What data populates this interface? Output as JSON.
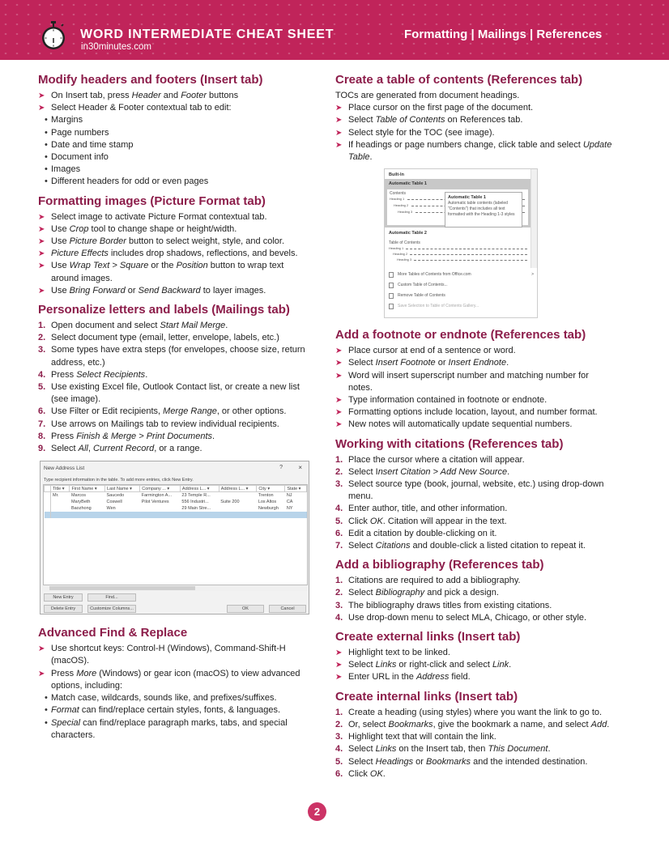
{
  "header": {
    "title": "WORD INTERMEDIATE CHEAT SHEET",
    "site": "in30minutes.com",
    "subtitle": "Formatting | Mailings | References",
    "logo_icon": "stopwatch-icon",
    "brand_color": "#c0245a",
    "heading_color": "#8c1d4a"
  },
  "left": {
    "headers_footers": {
      "heading": "Modify headers and footers (Insert tab)",
      "items": [
        [
          "On Insert tab, press ",
          {
            "i": "Header"
          },
          " and ",
          {
            "i": "Footer"
          },
          " buttons"
        ],
        [
          "Select Header & Footer contextual tab to edit:"
        ]
      ],
      "sub_items": [
        "Margins",
        "Page numbers",
        "Date and time stamp",
        "Document info",
        "Images",
        "Different headers for odd or even pages"
      ]
    },
    "images": {
      "heading": "Formatting images (Picture Format tab)",
      "items": [
        [
          "Select image to activate Picture Format contextual tab."
        ],
        [
          "Use ",
          {
            "i": "Crop"
          },
          " tool to change shape or height/width."
        ],
        [
          "Use ",
          {
            "i": "Picture Border"
          },
          " button to select weight, style, and color."
        ],
        [
          {
            "i": "Picture Effects"
          },
          " includes drop shadows, reflections, and bevels."
        ],
        [
          "Use ",
          {
            "i": "Wrap Text > Square"
          },
          " or the ",
          {
            "i": "Position"
          },
          " button to wrap text around images."
        ],
        [
          "Use ",
          {
            "i": "Bring Forward"
          },
          " or ",
          {
            "i": "Send Backward"
          },
          " to layer images."
        ]
      ]
    },
    "mailings": {
      "heading": "Personalize letters and labels (Mailings tab)",
      "items": [
        [
          "Open document and select ",
          {
            "i": "Start Mail Merge"
          },
          "."
        ],
        [
          "Select document type (email, letter, envelope, labels, etc.)"
        ],
        [
          "Some types have extra steps (for envelopes, choose size, return address, etc.)"
        ],
        [
          "Press ",
          {
            "i": "Select Recipients"
          },
          "."
        ],
        [
          "Use existing Excel file, Outlook Contact list, or create a new list (see image)."
        ],
        [
          "Use Filter or Edit recipients, ",
          {
            "i": "Merge Range"
          },
          ", or other options."
        ],
        [
          "Use arrows on Mailings tab to review individual recipients."
        ],
        [
          "Press ",
          {
            "i": "Finish & Merge > Print Documents"
          },
          "."
        ],
        [
          "Select ",
          {
            "i": "All"
          },
          ", ",
          {
            "i": "Current Record"
          },
          ", or a range."
        ]
      ]
    },
    "address_dialog": {
      "title": "New Address List",
      "help": "?",
      "close": "×",
      "hint": "Type recipient information in the table. To add more entries, click New Entry.",
      "columns": [
        "Title",
        "First Name",
        "Last Name",
        "Company ...",
        "Address L...",
        "Address L...",
        "City",
        "State"
      ],
      "rows": [
        [
          "Mr.",
          "Marcos",
          "Saucedo",
          "Farmington A...",
          "23 Temple R...",
          "",
          "Trenton",
          "NJ"
        ],
        [
          "",
          "MaryBeth",
          "Coswell",
          "Pilot Ventures",
          "556 Industri...",
          "Suite 200",
          "Los Altos",
          "CA"
        ],
        [
          "",
          "Baozhong",
          "Wen",
          "",
          "29 Main Stre...",
          "",
          "Newburgh",
          "NY"
        ],
        [
          "",
          "",
          "",
          "",
          "",
          "",
          "",
          ""
        ]
      ],
      "buttons": {
        "new_entry": "New Entry",
        "find": "Find...",
        "delete_entry": "Delete Entry",
        "customize": "Customize Columns...",
        "ok": "OK",
        "cancel": "Cancel"
      }
    },
    "find_replace": {
      "heading": "Advanced Find & Replace",
      "items": [
        [
          "Use shortcut keys: Control-H (Windows), Command-Shift-H (macOS)."
        ],
        [
          "Press ",
          {
            "i": "More"
          },
          " (Windows) or gear icon (macOS) to view advanced options, including:"
        ]
      ],
      "sub_items": [
        [
          "Match case, wildcards, sounds like, and prefixes/suffixes."
        ],
        [
          {
            "i": "Format"
          },
          " can find/replace certain styles, fonts, & languages."
        ],
        [
          {
            "i": "Special"
          },
          " can find/replace paragraph marks, tabs, and special characters."
        ]
      ]
    }
  },
  "right": {
    "toc": {
      "heading": "Create a table of contents (References tab)",
      "intro": "TOCs are generated from document headings.",
      "items": [
        [
          "Place cursor on the first page of the document."
        ],
        [
          "Select ",
          {
            "i": "Table of Contents"
          },
          " on References tab."
        ],
        [
          "Select style for the TOC (see image)."
        ],
        [
          "If headings or page numbers change, click table and select ",
          {
            "i": "Update Table"
          },
          "."
        ]
      ],
      "image": {
        "builtin": "Built-In",
        "auto1": "Automatic Table 1",
        "contents": "Contents",
        "h1": "Heading 1",
        "h2": "Heading 2",
        "h3": "Heading 3",
        "tip_title": "Automatic Table 1",
        "tip_text": "Automatic table contents (labeled \"Contents\") that includes all text formatted with the Heading 1-3 styles",
        "auto2": "Automatic Table 2",
        "toc_label": "Table of Contents",
        "menu": [
          {
            "label": "More Tables of Contents from Office.com",
            "disabled": false
          },
          {
            "label": "Custom Table of Contents...",
            "disabled": false
          },
          {
            "label": "Remove Table of Contents",
            "disabled": false
          },
          {
            "label": "Save Selection to Table of Contents Gallery...",
            "disabled": true
          }
        ],
        "submenu_arrow": ">"
      }
    },
    "footnote": {
      "heading": "Add a footnote or endnote (References tab)",
      "items": [
        [
          "Place cursor at end of a sentence or word."
        ],
        [
          "Select ",
          {
            "i": "Insert Footnote"
          },
          " or ",
          {
            "i": "Insert Endnote"
          },
          "."
        ],
        [
          "Word will insert superscript number and matching number for notes."
        ],
        [
          "Type information contained in footnote or endnote."
        ],
        [
          "Formatting options include location, layout, and number format."
        ],
        [
          "New notes will automatically update sequential numbers."
        ]
      ]
    },
    "citations": {
      "heading": "Working with citations (References tab)",
      "items": [
        [
          "Place the cursor where a citation will appear."
        ],
        [
          "Select I",
          {
            "i": "nsert Citation > Add New Source"
          },
          "."
        ],
        [
          "Select source type (book, journal, website, etc.) using drop-down menu."
        ],
        [
          "Enter author, title, and other information."
        ],
        [
          "Click ",
          {
            "i": "OK"
          },
          ". Citation will appear in the text."
        ],
        [
          "Edit a citation by double-clicking on it."
        ],
        [
          "Select ",
          {
            "i": "Citations"
          },
          " and double-click a listed citation to repeat it."
        ]
      ]
    },
    "bibliography": {
      "heading": "Add a bibliography (References tab)",
      "items": [
        [
          "Citations are required to add a bibliography."
        ],
        [
          "Select ",
          {
            "i": "Bibliography"
          },
          " and pick a design."
        ],
        [
          "The bibliography draws titles from existing citations."
        ],
        [
          "Use drop-down menu to select MLA, Chicago, or other style."
        ]
      ]
    },
    "external_links": {
      "heading": "Create external links (Insert tab)",
      "items": [
        [
          "Highlight text to be linked."
        ],
        [
          "Select ",
          {
            "i": "Links"
          },
          " or right-click and select ",
          {
            "i": "Link"
          },
          "."
        ],
        [
          "Enter URL in the ",
          {
            "i": "Address"
          },
          " field."
        ]
      ]
    },
    "internal_links": {
      "heading": "Create internal links (Insert tab)",
      "items": [
        [
          "Create a heading (using styles) where you want the link to go to."
        ],
        [
          "Or, select ",
          {
            "i": "Bookmarks"
          },
          ", give the bookmark a name, and select ",
          {
            "i": "Add"
          },
          "."
        ],
        [
          "Highlight text that will contain the link."
        ],
        [
          "Select ",
          {
            "i": "Links"
          },
          " on the Insert tab, then ",
          {
            "i": "This Document"
          },
          "."
        ],
        [
          "Select ",
          {
            "i": "Headings"
          },
          " or ",
          {
            "i": "Bookmarks"
          },
          " and the intended destination."
        ],
        [
          "Click ",
          {
            "i": "OK"
          },
          "."
        ]
      ]
    }
  },
  "footer": {
    "page_number": "2"
  }
}
